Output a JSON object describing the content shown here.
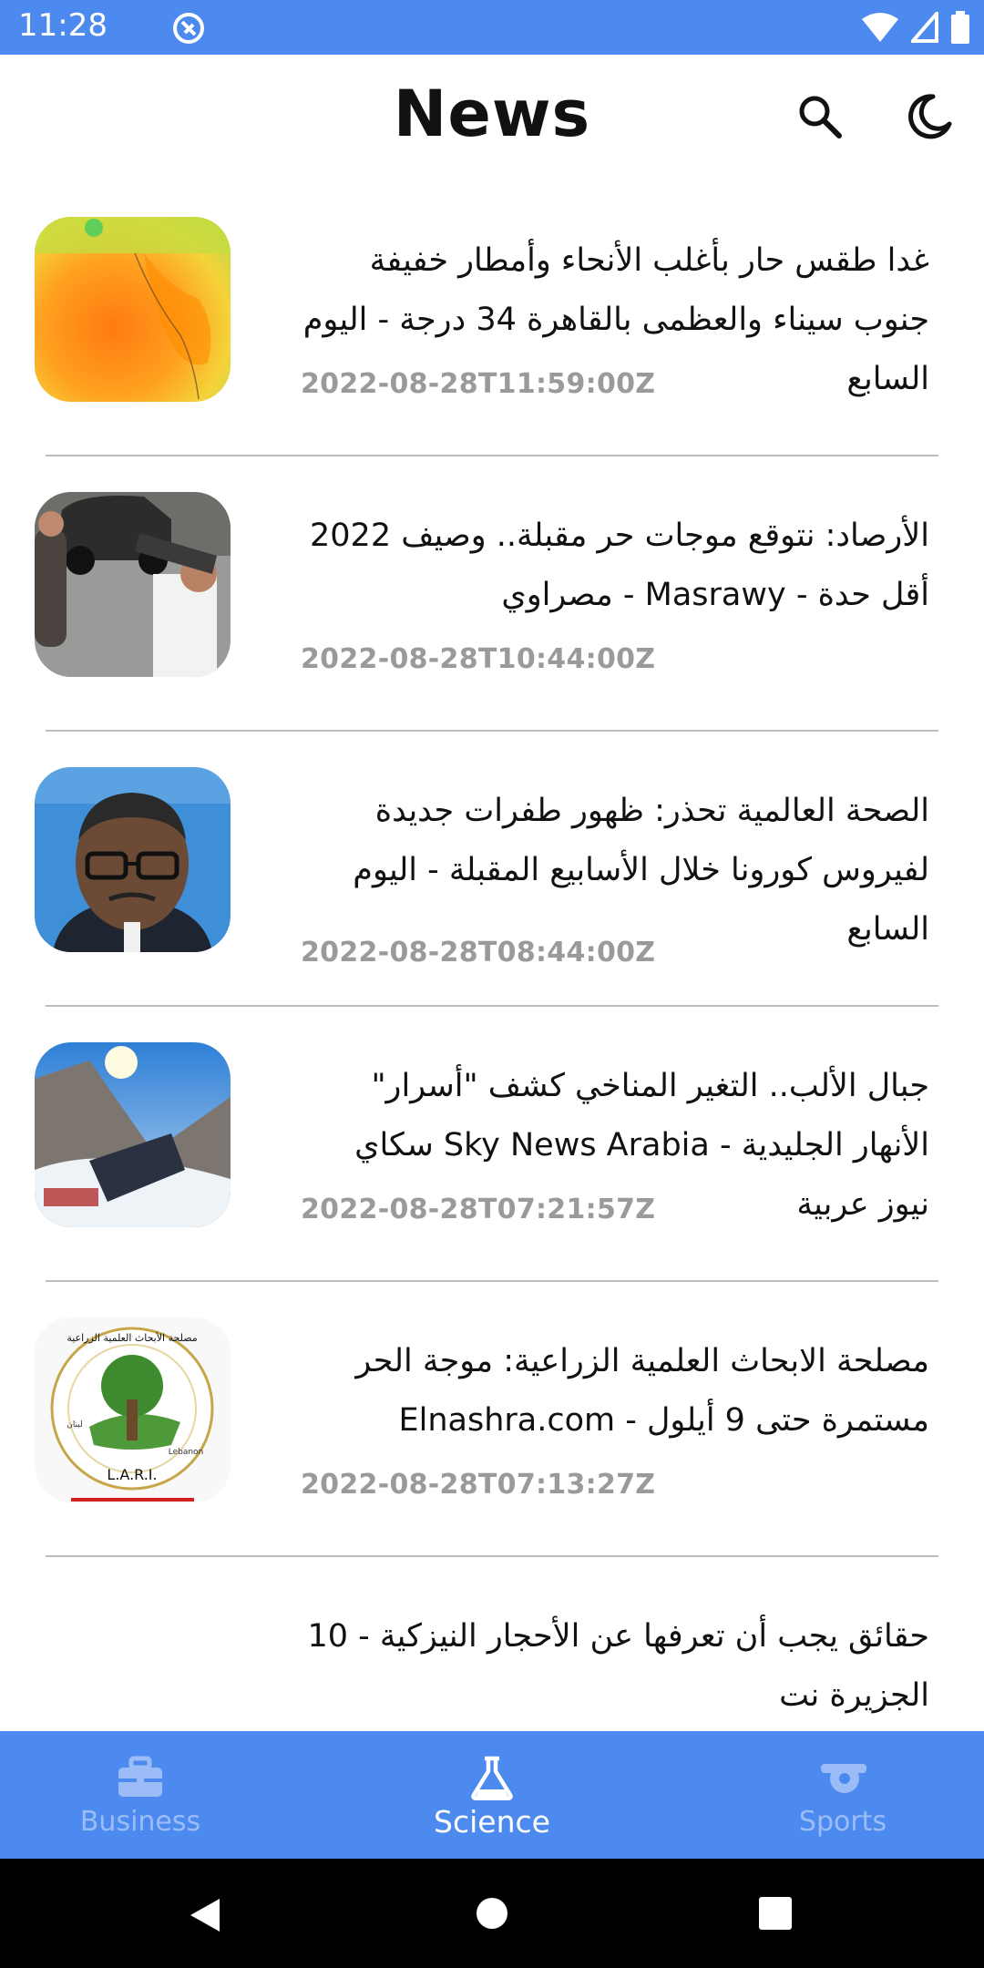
{
  "status_bar": {
    "time": "11:28"
  },
  "app_bar": {
    "title": "News"
  },
  "articles": [
    {
      "title": "غدا طقس حار بأغلب الأنحاء وأمطار خفيفة جنوب سيناء والعظمى بالقاهرة 34 درجة - اليوم السابع",
      "date": "2022-08-28T11:59:00Z"
    },
    {
      "title": "الأرصاد: نتوقع موجات حر مقبلة.. وصيف 2022 أقل حدة - Masrawy - مصراوي",
      "date": "2022-08-28T10:44:00Z"
    },
    {
      "title": "الصحة العالمية تحذر: ظهور طفرات جديدة لفيروس كورونا خلال الأسابيع المقبلة - اليوم السابع",
      "date": "2022-08-28T08:44:00Z"
    },
    {
      "title": "جبال الألب.. التغير المناخي كشف \"أسرار\" الأنهار الجليدية - Sky News Arabia سكاي نيوز عربية",
      "date": "2022-08-28T07:21:57Z"
    },
    {
      "title": "مصلحة الابحاث العلمية الزراعية: موجة الحر مستمرة حتى 9 أيلول - Elnashra.com",
      "date": "2022-08-28T07:13:27Z"
    },
    {
      "title": "حقائق يجب أن تعرفها عن الأحجار النيزكية - 10 الجزيرة نت",
      "date": ""
    }
  ],
  "thumbnails": {
    "logo_text_top": "مصلحة الأبحاث العلمية الزراعية",
    "logo_text_side": "لبنان",
    "logo_text_right": "Lebanon",
    "logo_text_bottom": "L.A.R.I."
  },
  "bottom_nav": {
    "items": [
      {
        "label": "Business",
        "icon": "briefcase-icon",
        "active": false
      },
      {
        "label": "Science",
        "icon": "flask-icon",
        "active": true
      },
      {
        "label": "Sports",
        "icon": "whistle-icon",
        "active": false
      }
    ]
  },
  "colors": {
    "primary": "#4d8af0",
    "date_gray": "#9a9a9a",
    "inactive_nav": "#9bbcf6"
  }
}
